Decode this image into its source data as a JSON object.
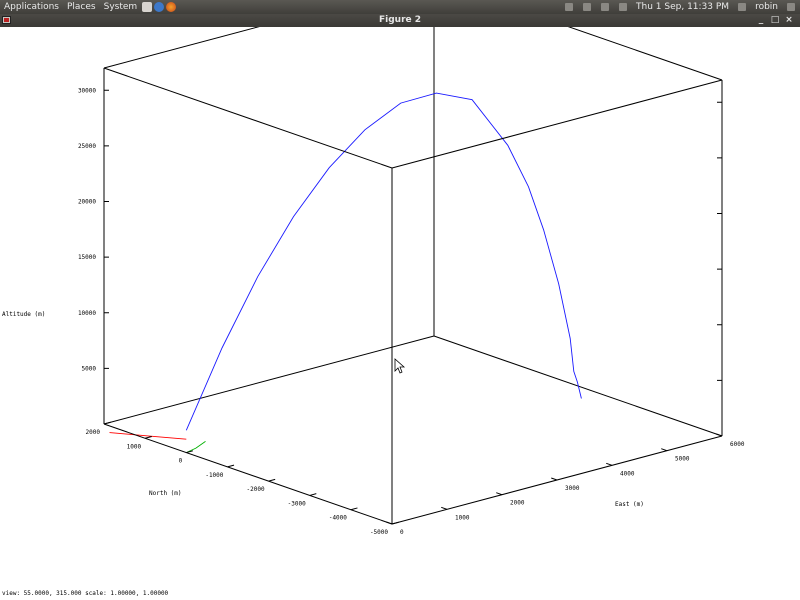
{
  "topbar": {
    "menus": [
      "Applications",
      "Places",
      "System"
    ],
    "clock": "Thu 1 Sep, 11:33 PM",
    "user": "robin"
  },
  "window": {
    "title": "Figure 2",
    "buttons": {
      "minimize": "_",
      "maximize": "□",
      "close": "×"
    }
  },
  "status": {
    "text": "view: 55.0000, 315.000   scale: 1.00000, 1.00000"
  },
  "chart_data": {
    "type": "line",
    "title": "",
    "xlabel": "East (m)",
    "ylabel": "North (m)",
    "zlabel": "Altitude (m)",
    "xlim": [
      0,
      6000
    ],
    "ylim": [
      -5000,
      2000
    ],
    "zlim": [
      0,
      32000
    ],
    "xticks": [
      "0",
      "1000",
      "2000",
      "3000",
      "4000",
      "5000",
      "6000"
    ],
    "yticks": [
      "2000",
      "1000",
      "0",
      "-1000",
      "-2000",
      "-3000",
      "-4000",
      "-5000"
    ],
    "zticks": [
      "5000",
      "10000",
      "15000",
      "20000",
      "25000",
      "30000"
    ],
    "series": [
      {
        "color": "#1a1aff",
        "x": [
          0,
          500,
          1000,
          1500,
          2000,
          2500,
          3000,
          3500,
          4000,
          4500,
          4800,
          5000,
          5200,
          5350,
          5400,
          5450,
          5500
        ],
        "y": [
          0,
          -200,
          -400,
          -600,
          -800,
          -1000,
          -1200,
          -1400,
          -1600,
          -1800,
          -1900,
          -2000,
          -2100,
          -2180,
          -2200,
          -2220,
          -2250
        ],
        "z": [
          2000,
          9000,
          15000,
          20000,
          24000,
          27000,
          29000,
          29500,
          28500,
          24000,
          20000,
          16000,
          11000,
          6000,
          3000,
          2000,
          500
        ]
      },
      {
        "color": "#ff0000",
        "x": [
          -200,
          -100,
          0
        ],
        "y": [
          1600,
          800,
          0
        ],
        "z": [
          0,
          600,
          1200
        ]
      },
      {
        "color": "#00b000",
        "x": [
          0,
          100,
          200
        ],
        "y": [
          0,
          -100,
          -200
        ],
        "z": [
          0,
          400,
          1000
        ]
      }
    ]
  }
}
